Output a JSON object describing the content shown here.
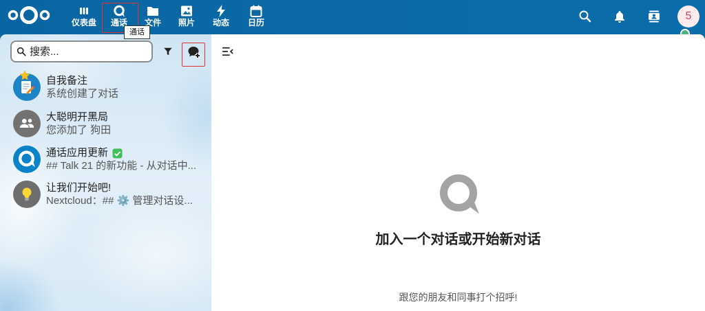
{
  "colors": {
    "header": "#0a69a6",
    "highlight": "#e0322e",
    "empty_logo": "#a3a3a3",
    "status_online": "#49b382",
    "user_avatar_bg": "#fdebee",
    "user_avatar_text": "#c8475a",
    "check_green": "#3ec15a"
  },
  "header": {
    "logo_icon": "nextcloud-logo-icon",
    "nav": [
      {
        "label": "仪表盘",
        "icon": "dashboard-icon"
      },
      {
        "label": "通话",
        "icon": "talk-icon",
        "active": true
      },
      {
        "label": "文件",
        "icon": "folder-icon"
      },
      {
        "label": "照片",
        "icon": "photos-icon"
      },
      {
        "label": "动态",
        "icon": "activity-icon"
      },
      {
        "label": "日历",
        "icon": "calendar-icon"
      }
    ],
    "tooltip": "通话",
    "actions": [
      {
        "icon": "search-icon"
      },
      {
        "icon": "bell-icon"
      },
      {
        "icon": "contacts-icon"
      }
    ],
    "user_avatar": {
      "text": "5",
      "status_color": "#49b382"
    }
  },
  "sidebar": {
    "search": {
      "placeholder": "搜索...",
      "value": ""
    },
    "filter_icon": "filter-icon",
    "new_conversation_icon": "chat-plus-icon",
    "conversations": [
      {
        "title": "自我备注",
        "subtitle": "系统创建了对话",
        "avatar_icon": "memo-emoji-icon",
        "favorite": true
      },
      {
        "title": "大聪明开黑局",
        "subtitle": "您添加了 狗田",
        "avatar_icon": "group-icon"
      },
      {
        "title": "通话应用更新",
        "title_icon": "check-mark-emoji-icon",
        "subtitle": "## Talk 21 的新功能 - 从对话中...",
        "avatar_icon": "talk-logo-icon"
      },
      {
        "title": "让我们开始吧!",
        "subtitle": "Nextcloud：## ⚙️ 管理对话设...",
        "avatar_icon": "lightbulb-emoji-icon"
      }
    ]
  },
  "main": {
    "toggle_icon": "menu-open-icon",
    "empty_state": {
      "icon": "talk-logo-icon",
      "title": "加入一个对话或开始新对话",
      "subtitle": "跟您的朋友和同事打个招呼!"
    }
  }
}
